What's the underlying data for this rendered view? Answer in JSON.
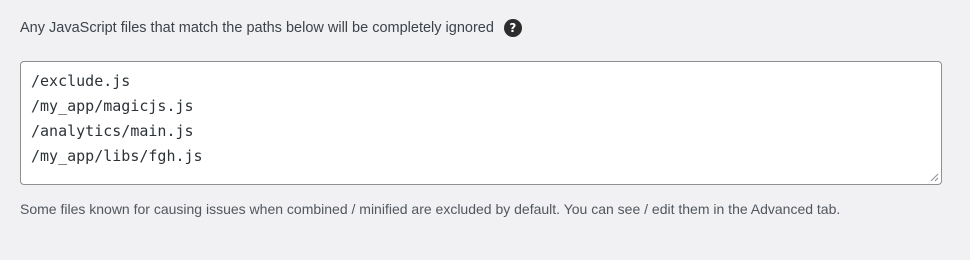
{
  "description": "Any JavaScript files that match the paths below will be completely ignored",
  "help_icon": {
    "glyph": "?",
    "name": "question-circle-icon"
  },
  "exclude_paths": {
    "value": "/exclude.js\n/my_app/magicjs.js\n/analytics/main.js\n/my_app/libs/fgh.js"
  },
  "note": "Some files known for causing issues when combined / minified are excluded by default. You can see / edit them in the Advanced tab.",
  "colors": {
    "background": "#f1f1f3",
    "text": "#3c434a",
    "border": "#8c8f94",
    "icon": "#2c2c2c"
  }
}
